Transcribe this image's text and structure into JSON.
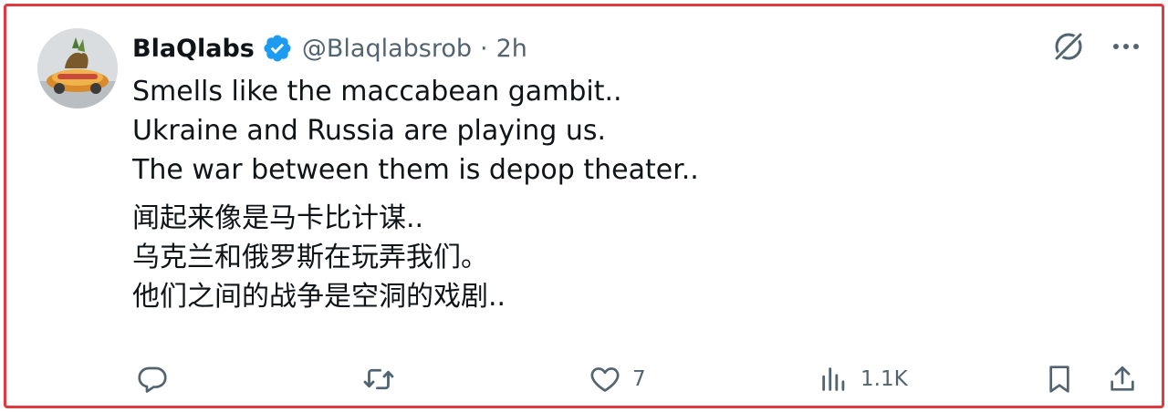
{
  "tweet": {
    "author": {
      "display_name": "BlaQlabs",
      "handle": "@Blaqlabsrob",
      "verified": true,
      "avatar_icon": "toy-car-avatar"
    },
    "separator": "·",
    "time": "2h",
    "text_en": [
      "Smells like the maccabean gambit..",
      "Ukraine and Russia are playing us.",
      "The war between them is depop theater.."
    ],
    "text_zh": [
      "闻起来像是马卡比计谋..",
      "乌克兰和俄罗斯在玩弄我们。",
      "他们之间的战争是空洞的戏剧.."
    ],
    "actions": {
      "reply": {
        "icon": "reply-icon",
        "count": ""
      },
      "retweet": {
        "icon": "retweet-icon",
        "count": ""
      },
      "like": {
        "icon": "heart-icon",
        "count": "7"
      },
      "views": {
        "icon": "views-icon",
        "count": "1.1K"
      },
      "bookmark": {
        "icon": "bookmark-icon"
      },
      "share": {
        "icon": "share-icon"
      }
    },
    "top_icons": [
      "grok-icon",
      "more-icon"
    ]
  },
  "colors": {
    "frame_border": "#e0393e",
    "verified_blue": "#1d9bf0",
    "text_primary": "#0f1419",
    "text_secondary": "#536471"
  }
}
